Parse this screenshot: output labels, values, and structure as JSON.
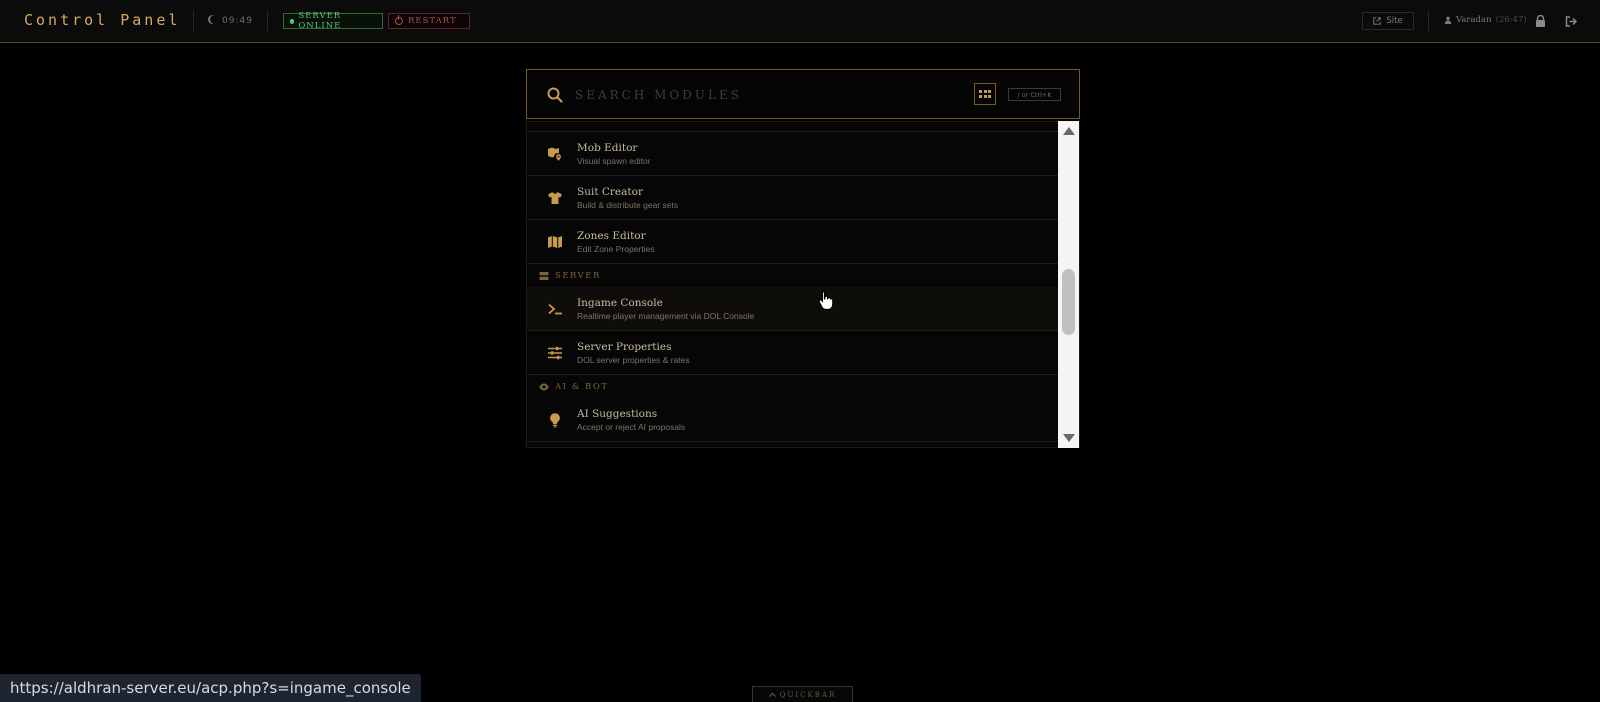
{
  "header": {
    "brand": "Control Panel",
    "time": "09:49",
    "server_status": "SERVER ONLINE",
    "restart_label": "RESTART",
    "site_label": "Site",
    "username": "Varadan",
    "user_level": "(26:47)"
  },
  "search": {
    "placeholder": "SEARCH MODULES",
    "value": "",
    "shortcut": "/ or Ctrl+K"
  },
  "results": [
    {
      "kind": "item",
      "icon": "map-marker-icon",
      "title": "Mob Editor",
      "subtitle": "Visual spawn editor"
    },
    {
      "kind": "item",
      "icon": "shirt-icon",
      "title": "Suit Creator",
      "subtitle": "Build & distribute gear sets"
    },
    {
      "kind": "item",
      "icon": "map-icon",
      "title": "Zones Editor",
      "subtitle": "Edit Zone Properties"
    },
    {
      "kind": "section",
      "icon": "server-icon",
      "title": "SERVER"
    },
    {
      "kind": "item",
      "icon": "terminal-icon",
      "title": "Ingame Console",
      "subtitle": "Realtime player management via DOL Console",
      "active": true
    },
    {
      "kind": "item",
      "icon": "sliders-icon",
      "title": "Server Properties",
      "subtitle": "DOL server properties & rates"
    },
    {
      "kind": "section",
      "icon": "eye-icon",
      "title": "AI & BOT"
    },
    {
      "kind": "item",
      "icon": "lightbulb-icon",
      "title": "AI Suggestions",
      "subtitle": "Accept or reject AI proposals"
    }
  ],
  "status_bar": {
    "url": "https://aldhran-server.eu/acp.php?s=ingame_console"
  },
  "quickbar": {
    "label": "QUICKBAR"
  },
  "colors": {
    "accent": "#c79a50",
    "online": "#45d36a",
    "restart": "#a8504a",
    "background": "#000000"
  }
}
